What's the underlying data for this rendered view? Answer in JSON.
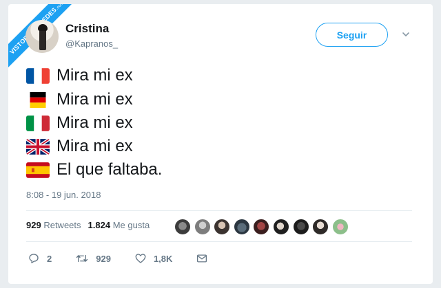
{
  "watermark": {
    "text": "VISTOENLASREDES",
    "suffix": ".com"
  },
  "user": {
    "name": "Cristina",
    "handle": "@Kapranos_"
  },
  "follow_label": "Seguir",
  "tweet_lines": [
    {
      "flag": "france-flag-icon",
      "text": "Mira mi ex"
    },
    {
      "flag": "germany-flag-icon",
      "text": "Mira mi ex"
    },
    {
      "flag": "italy-flag-icon",
      "text": "Mira mi ex"
    },
    {
      "flag": "uk-flag-icon",
      "text": "Mira mi ex"
    },
    {
      "flag": "spain-flag-icon",
      "text": "El que faltaba."
    }
  ],
  "timestamp": "8:08 - 19 jun. 2018",
  "stats": {
    "retweets_count": "929",
    "retweets_label": "Retweets",
    "likes_count": "1.824",
    "likes_label": "Me gusta"
  },
  "actions": {
    "replies": "2",
    "retweets": "929",
    "likes": "1,8K"
  },
  "colors": {
    "accent": "#1da1f2",
    "text": "#14171a",
    "muted": "#657786"
  }
}
